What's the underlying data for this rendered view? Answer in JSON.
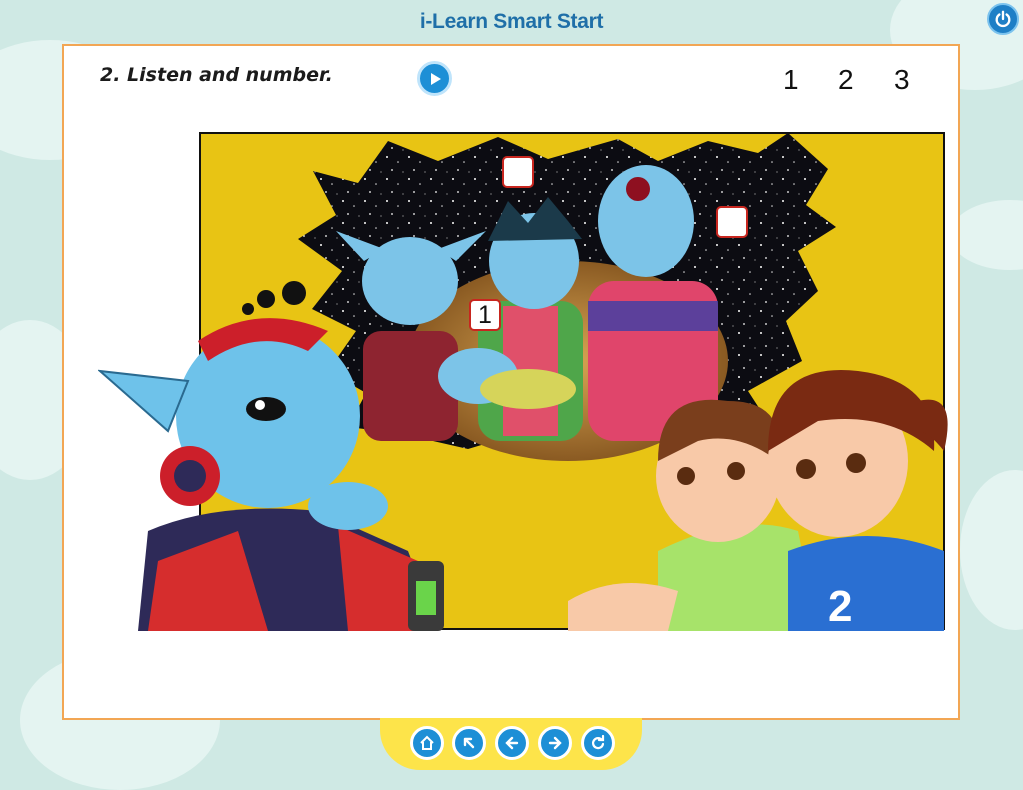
{
  "app": {
    "title": "i-Learn Smart Start"
  },
  "exercise": {
    "instruction": "2. Listen and number.",
    "number_options": [
      "1",
      "2",
      "3"
    ],
    "answer_boxes": [
      "",
      "1",
      ""
    ]
  },
  "icons": {
    "power": "power-icon",
    "play": "play-audio-icon",
    "nav": [
      "home-icon",
      "back-to-menu-icon",
      "previous-icon",
      "next-icon",
      "replay-icon"
    ]
  },
  "colors": {
    "accent_blue": "#1d8fd6",
    "panel_border": "#f2a654",
    "nav_bar": "#fde44a",
    "box_border": "#c8261f",
    "title": "#1f6fa8"
  }
}
